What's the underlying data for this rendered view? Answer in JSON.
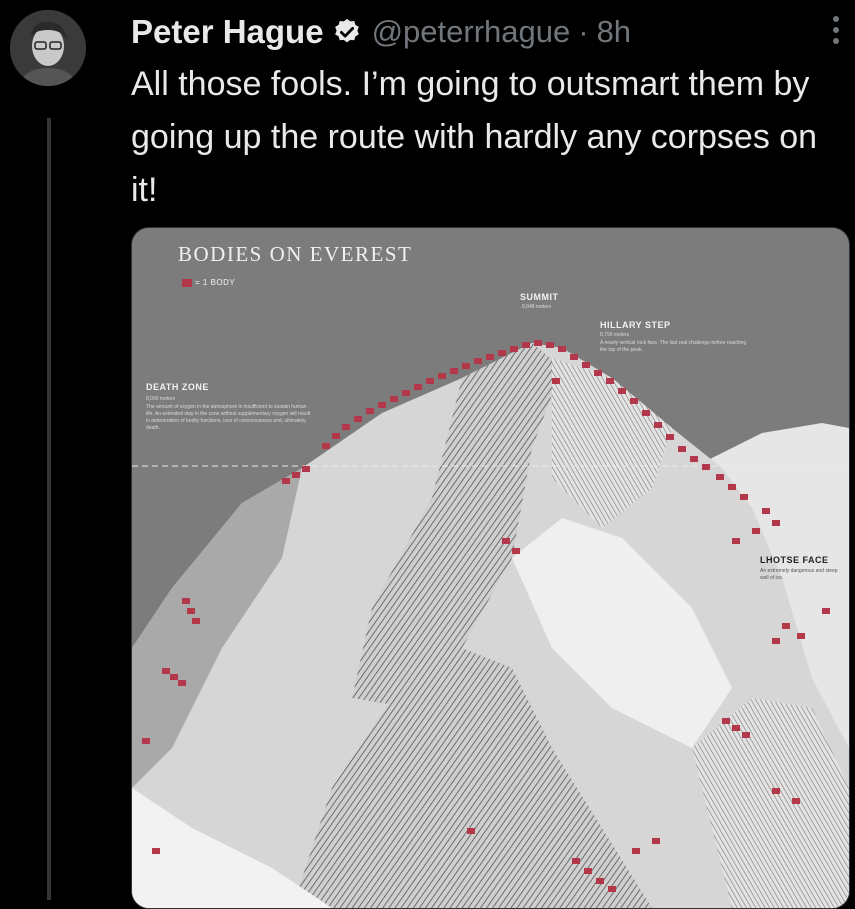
{
  "tweet": {
    "author_name": "Peter Hague",
    "handle": "@peterrhague",
    "separator": "·",
    "time": "8h",
    "text": "All those fools. I’m going to outsmart them by going up the route with hardly any corpses on it!"
  },
  "icons": {
    "verified": "verified-badge-icon",
    "more": "more-options-icon"
  },
  "colors": {
    "background": "#000000",
    "primary_text": "#e7e9ea",
    "secondary_text": "#71767b",
    "verified_blue": "#ffffff",
    "flag_red": "#b3384a"
  },
  "media": {
    "title": "BODIES ON EVEREST",
    "legend": "= 1 BODY",
    "labels": {
      "summit": "SUMMIT",
      "summit_sub": "8,848 meters",
      "hillary_step": "HILLARY STEP",
      "hillary_step_sub": "8,790 meters",
      "hillary_step_desc": "A nearly vertical rock face. The last real challenge before reaching the top of the peak.",
      "death_zone": "DEATH ZONE",
      "death_zone_sub": "8,000 meters",
      "death_zone_desc": "The amount of oxygen in the atmosphere is insufficient to sustain human life. An extended stay in the zone without supplementary oxygen will result in deterioration of bodily functions, loss of consciousness and, ultimately, death.",
      "lhotse_face": "LHOTSE FACE",
      "lhotse_face_desc": "An extremely dangerous and steep wall of ice."
    }
  }
}
